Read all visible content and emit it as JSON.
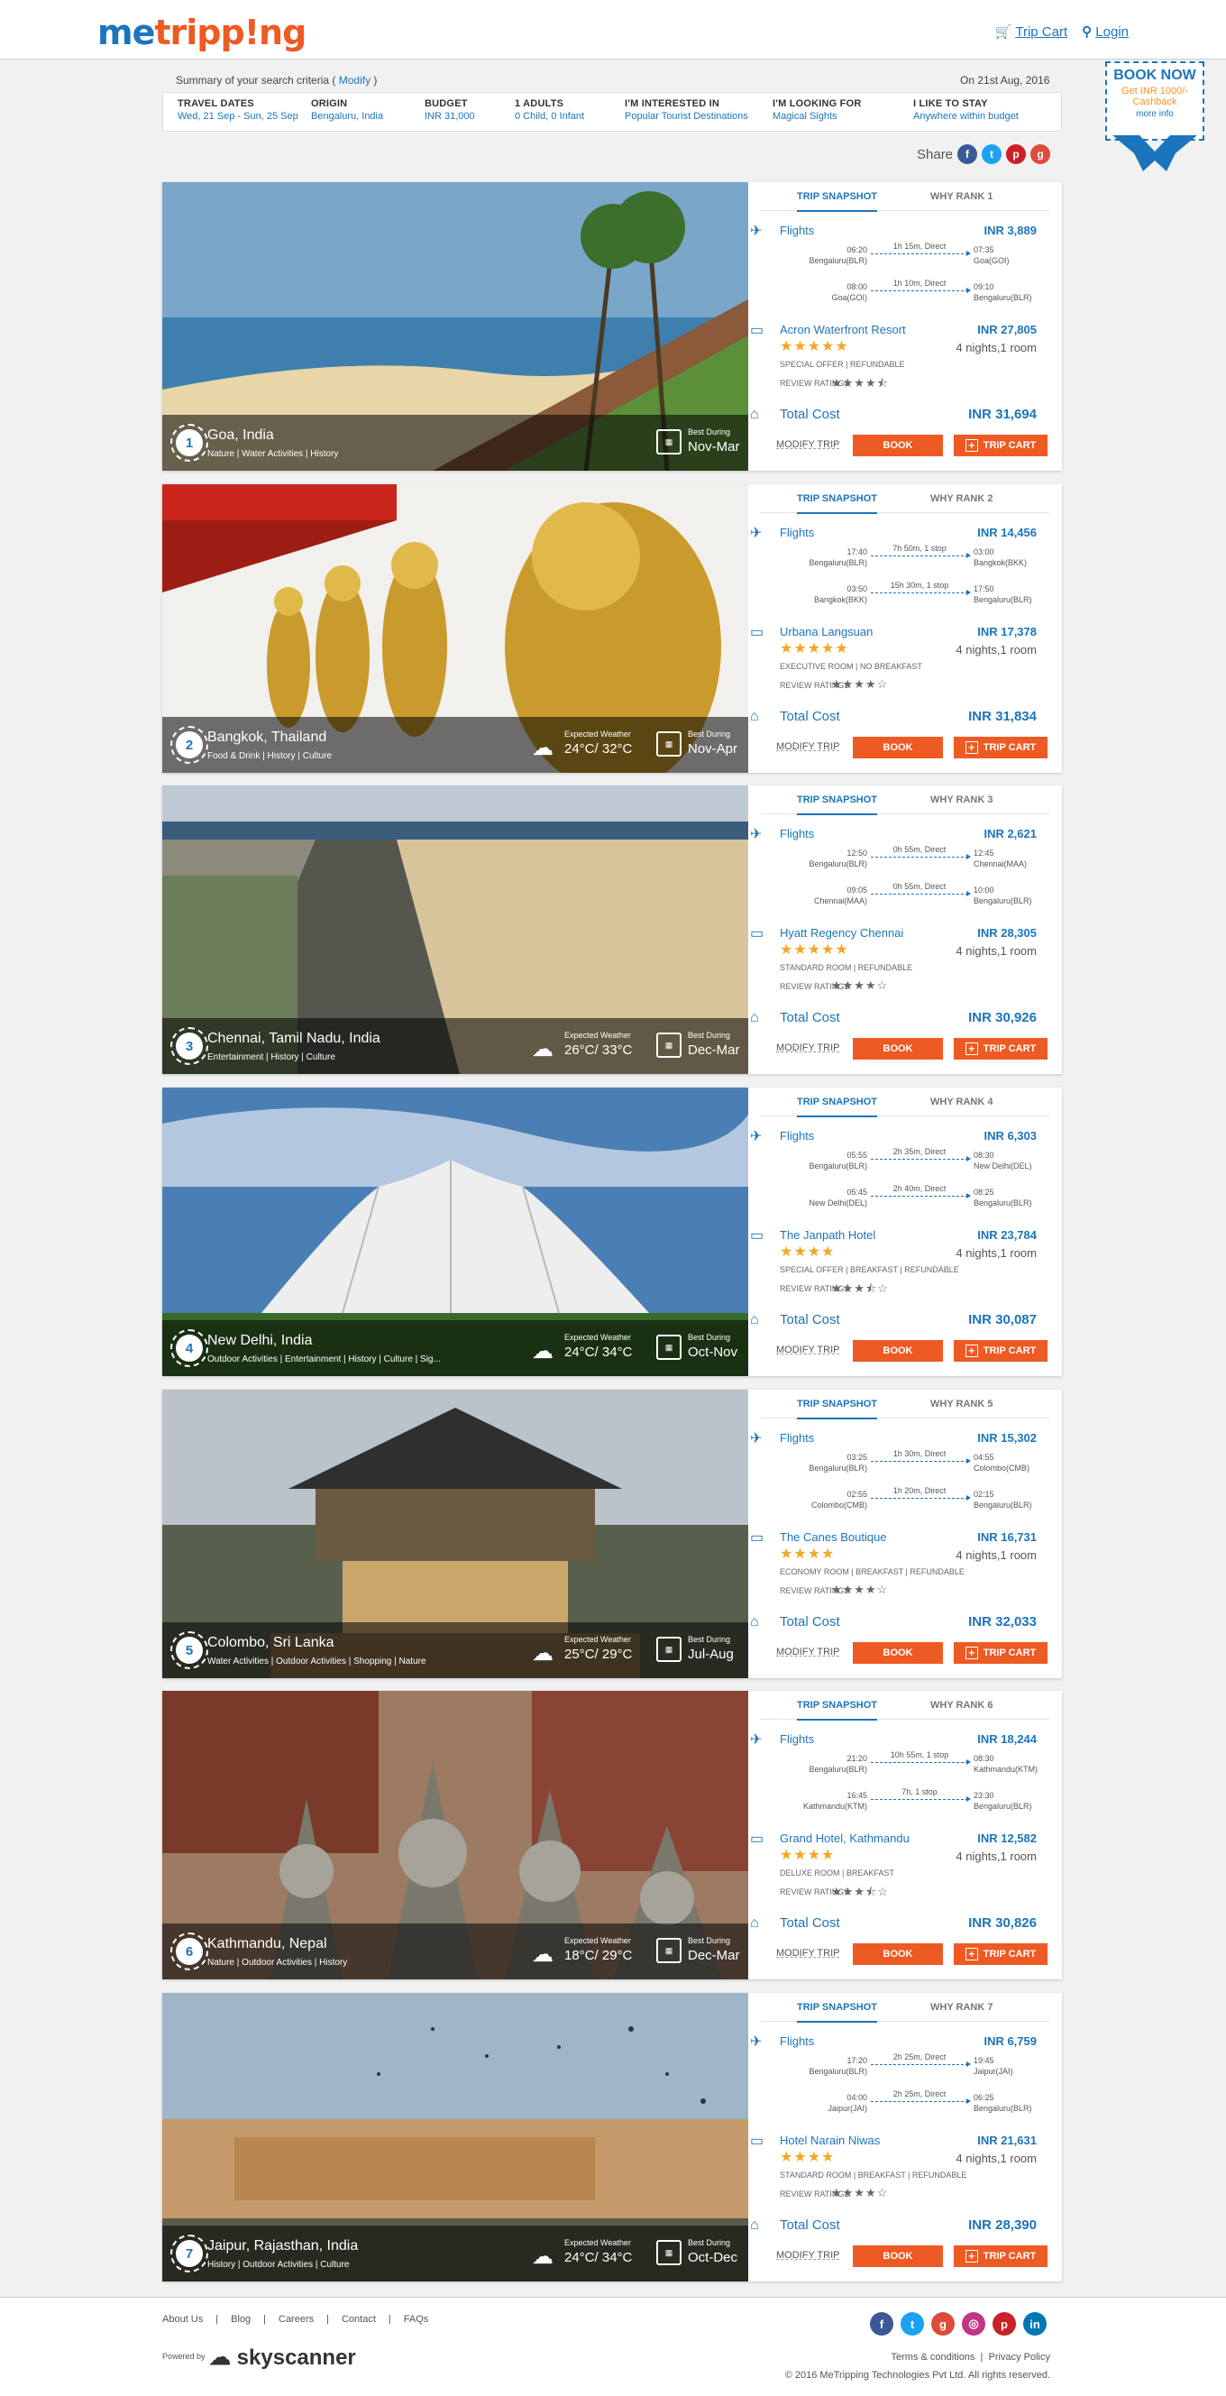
{
  "header": {
    "logo_pre": "me",
    "logo_mid": "tripp!ng",
    "trip_cart": "Trip Cart",
    "login": "Login"
  },
  "summary": {
    "label": "Summary of your search criteria (",
    "modify": "Modify",
    "close": ")",
    "date": "On 21st Aug, 2016"
  },
  "criteria": [
    {
      "key": "TRAVEL DATES",
      "value": "Wed, 21 Sep - Sun, 25 Sep"
    },
    {
      "key": "ORIGIN",
      "value": "Bengaluru, India"
    },
    {
      "key": "BUDGET",
      "value": "INR 31,000"
    },
    {
      "key": "1 ADULTS",
      "value": "0 Child, 0 Infant"
    },
    {
      "key": "I'M INTERESTED IN",
      "value": "Popular Tourist Destinations"
    },
    {
      "key": "I'M LOOKING FOR",
      "value": "Magical Sights"
    },
    {
      "key": "I LIKE TO STAY",
      "value": "Anywhere within budget"
    }
  ],
  "share": {
    "label": "Share"
  },
  "booknow": {
    "title": "BOOK NOW",
    "sub": "Get INR 1000/- Cashback",
    "more": "more info"
  },
  "labels": {
    "snapshot": "TRIP SNAPSHOT",
    "flights": "Flights",
    "total": "Total Cost",
    "modify": "MODIFY TRIP",
    "book": "BOOK",
    "cart": "TRIP CART",
    "review": "REVIEW RATINGS",
    "expected": "Expected Weather",
    "best": "Best During"
  },
  "trips": [
    {
      "rank": "1",
      "why": "WHY RANK 1",
      "dest": "Goa, India",
      "tags": "Nature | Water Activities | History",
      "weather": "",
      "best": "Nov-Mar",
      "flight_price": "INR 3,889",
      "legs": [
        {
          "dt": "06:20",
          "dc": "Bengaluru(BLR)",
          "dur": "1h 15m, Direct",
          "at": "07:35",
          "ac": "Goa(GOI)"
        },
        {
          "dt": "08:00",
          "dc": "Goa(GOI)",
          "dur": "1h 10m, Direct",
          "at": "09:10",
          "ac": "Bengaluru(BLR)"
        }
      ],
      "hotel": "Acron Waterfront Resort",
      "hotel_price": "INR 27,805",
      "stars": "★★★★★",
      "nights": "4 nights,1 room",
      "room": "SPECIAL OFFER | REFUNDABLE",
      "rstars": "★★★★⯪",
      "total": "INR 31,694"
    },
    {
      "rank": "2",
      "why": "WHY RANK 2",
      "dest": "Bangkok, Thailand",
      "tags": "Food & Drink | History | Culture",
      "weather": "24°C/ 32°C",
      "best": "Nov-Apr",
      "flight_price": "INR 14,456",
      "legs": [
        {
          "dt": "17:40",
          "dc": "Bengaluru(BLR)",
          "dur": "7h 50m, 1 stop",
          "at": "03:00",
          "ac": "Bangkok(BKK)"
        },
        {
          "dt": "03:50",
          "dc": "Bangkok(BKK)",
          "dur": "15h 30m, 1 stop",
          "at": "17:50",
          "ac": "Bengaluru(BLR)"
        }
      ],
      "hotel": "Urbana Langsuan",
      "hotel_price": "INR 17,378",
      "stars": "★★★★★",
      "nights": "4 nights,1 room",
      "room": "EXECUTIVE ROOM | NO BREAKFAST",
      "rstars": "★★★★☆",
      "total": "INR 31,834"
    },
    {
      "rank": "3",
      "why": "WHY RANK 3",
      "dest": "Chennai, Tamil Nadu, India",
      "tags": "Entertainment | History | Culture",
      "weather": "26°C/ 33°C",
      "best": "Dec-Mar",
      "flight_price": "INR 2,621",
      "legs": [
        {
          "dt": "12:50",
          "dc": "Bengaluru(BLR)",
          "dur": "0h 55m, Direct",
          "at": "12:45",
          "ac": "Chennai(MAA)"
        },
        {
          "dt": "09:05",
          "dc": "Chennai(MAA)",
          "dur": "0h 55m, Direct",
          "at": "10:00",
          "ac": "Bengaluru(BLR)"
        }
      ],
      "hotel": "Hyatt Regency Chennai",
      "hotel_price": "INR 28,305",
      "stars": "★★★★★",
      "nights": "4 nights,1 room",
      "room": "STANDARD ROOM | REFUNDABLE",
      "rstars": "★★★★☆",
      "total": "INR 30,926"
    },
    {
      "rank": "4",
      "why": "WHY RANK 4",
      "dest": "New Delhi, India",
      "tags": "Outdoor Activities | Entertainment | History | Culture | Sig...",
      "weather": "24°C/ 34°C",
      "best": "Oct-Nov",
      "flight_price": "INR 6,303",
      "legs": [
        {
          "dt": "05:55",
          "dc": "Bengaluru(BLR)",
          "dur": "2h 35m, Direct",
          "at": "08:30",
          "ac": "New Delhi(DEL)"
        },
        {
          "dt": "05:45",
          "dc": "New Delhi(DEL)",
          "dur": "2h 40m, Direct",
          "at": "08:25",
          "ac": "Bengaluru(BLR)"
        }
      ],
      "hotel": "The Janpath Hotel",
      "hotel_price": "INR 23,784",
      "stars": "★★★★",
      "nights": "4 nights,1 room",
      "room": "SPECIAL OFFER | BREAKFAST | REFUNDABLE",
      "rstars": "★★★⯪☆",
      "total": "INR 30,087"
    },
    {
      "rank": "5",
      "why": "WHY RANK 5",
      "dest": "Colombo, Sri Lanka",
      "tags": "Water Activities | Outdoor Activities | Shopping | Nature",
      "weather": "25°C/ 29°C",
      "best": "Jul-Aug",
      "flight_price": "INR 15,302",
      "legs": [
        {
          "dt": "03:25",
          "dc": "Bengaluru(BLR)",
          "dur": "1h 30m, Direct",
          "at": "04:55",
          "ac": "Colombo(CMB)"
        },
        {
          "dt": "02:55",
          "dc": "Colombo(CMB)",
          "dur": "1h 20m, Direct",
          "at": "02:15",
          "ac": "Bengaluru(BLR)"
        }
      ],
      "hotel": "The Canes Boutique",
      "hotel_price": "INR 16,731",
      "stars": "★★★★",
      "nights": "4 nights,1 room",
      "room": "ECONOMY ROOM | BREAKFAST | REFUNDABLE",
      "rstars": "★★★★☆",
      "total": "INR 32,033"
    },
    {
      "rank": "6",
      "why": "WHY RANK 6",
      "dest": "Kathmandu, Nepal",
      "tags": "Nature | Outdoor Activities | History",
      "weather": "18°C/ 29°C",
      "best": "Dec-Mar",
      "flight_price": "INR 18,244",
      "legs": [
        {
          "dt": "21:20",
          "dc": "Bengaluru(BLR)",
          "dur": "10h 55m, 1 stop",
          "at": "08:30",
          "ac": "Kathmandu(KTM)"
        },
        {
          "dt": "16:45",
          "dc": "Kathmandu(KTM)",
          "dur": "7h, 1 stop",
          "at": "23:30",
          "ac": "Bengaluru(BLR)"
        }
      ],
      "hotel": "Grand Hotel, Kathmandu",
      "hotel_price": "INR 12,582",
      "stars": "★★★★",
      "nights": "4 nights,1 room",
      "room": "DELUXE ROOM | BREAKFAST",
      "rstars": "★★★⯪☆",
      "total": "INR 30,826"
    },
    {
      "rank": "7",
      "why": "WHY RANK 7",
      "dest": "Jaipur, Rajasthan, India",
      "tags": "History | Outdoor Activities | Culture",
      "weather": "24°C/ 34°C",
      "best": "Oct-Dec",
      "flight_price": "INR 6,759",
      "legs": [
        {
          "dt": "17:20",
          "dc": "Bengaluru(BLR)",
          "dur": "2h 25m, Direct",
          "at": "19:45",
          "ac": "Jaipur(JAI)"
        },
        {
          "dt": "04:00",
          "dc": "Jaipur(JAI)",
          "dur": "2h 25m, Direct",
          "at": "06:25",
          "ac": "Bengaluru(BLR)"
        }
      ],
      "hotel": "Hotel Narain Niwas",
      "hotel_price": "INR 21,631",
      "stars": "★★★★",
      "nights": "4 nights,1 room",
      "room": "STANDARD ROOM | BREAKFAST | REFUNDABLE",
      "rstars": "★★★★☆",
      "total": "INR 28,390"
    }
  ],
  "footer": {
    "links": [
      "About Us",
      "Blog",
      "Careers",
      "Contact",
      "FAQs"
    ],
    "powered": "Powered by",
    "brand": "skyscanner",
    "terms": "Terms & conditions",
    "privacy": "Privacy Policy",
    "copy": "© 2016 MeTripping Technologies Pvt Ltd. All rights reserved."
  },
  "colors": {
    "brand_blue": "#1c75bc",
    "brand_orange": "#ee5a24",
    "star": "#f5a623"
  }
}
